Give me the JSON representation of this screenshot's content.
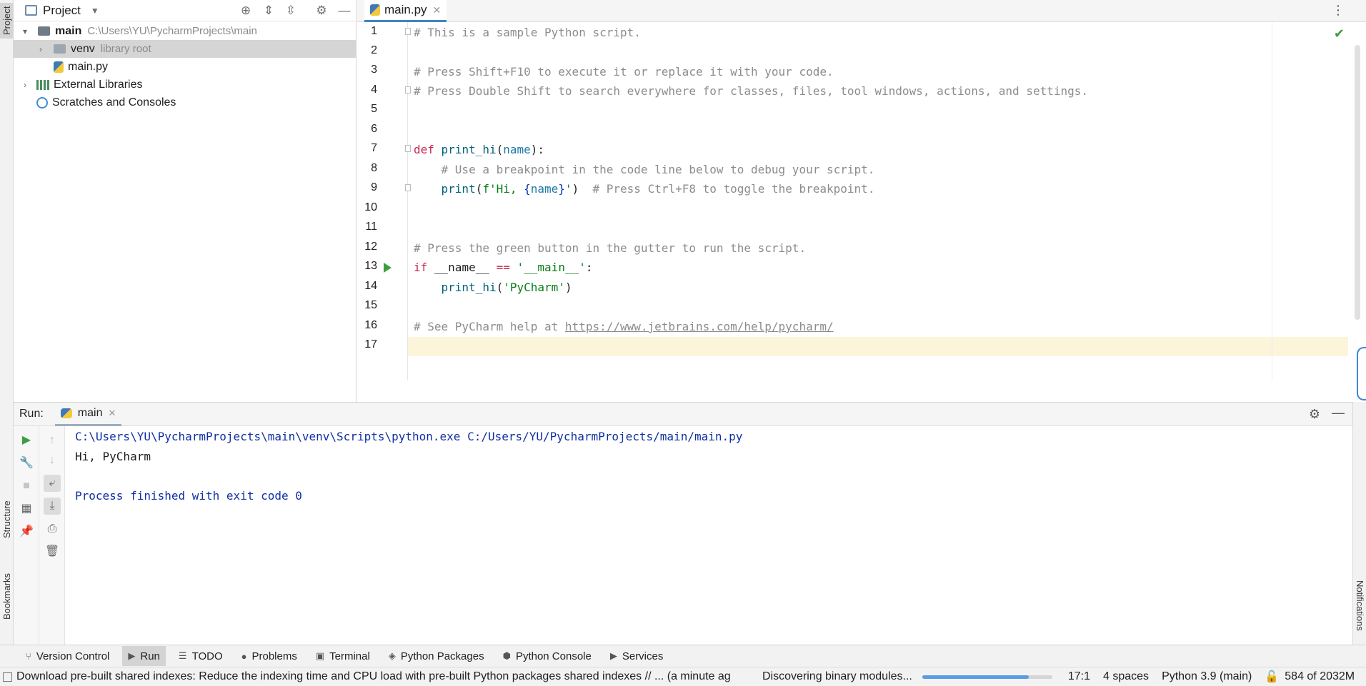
{
  "project_panel": {
    "title": "Project",
    "tree": [
      {
        "label": "main",
        "detail": "C:\\Users\\YU\\PycharmProjects\\main"
      },
      {
        "label": "venv",
        "detail": "library root"
      },
      {
        "label": "main.py"
      },
      {
        "label": "External Libraries"
      },
      {
        "label": "Scratches and Consoles"
      }
    ]
  },
  "left_stripe": {
    "project": "Project",
    "structure": "Structure",
    "bookmarks": "Bookmarks"
  },
  "editor": {
    "tab": "main.py",
    "line_numbers": [
      "1",
      "2",
      "3",
      "4",
      "5",
      "6",
      "7",
      "8",
      "9",
      "10",
      "11",
      "12",
      "13",
      "14",
      "15",
      "16",
      "17"
    ],
    "lines": {
      "l1": "# This is a sample Python script.",
      "l3": "# Press Shift+F10 to execute it or replace it with your code.",
      "l4": "# Press Double Shift to search everywhere for classes, files, tool windows, actions, and settings.",
      "l7_kw": "def",
      "l7_fn": "print_hi",
      "l7_p1": "(",
      "l7_param": "name",
      "l7_p2": "):",
      "l8": "# Use a breakpoint in the code line below to debug your script.",
      "l9_fn": "print",
      "l9_open": "(",
      "l9_str1": "f'Hi, ",
      "l9_brace": "{",
      "l9_param": "name",
      "l9_brace2": "}",
      "l9_str2": "'",
      "l9_close": ")",
      "l9_cmt": "# Press Ctrl+F8 to toggle the breakpoint.",
      "l12": "# Press the green button in the gutter to run the script.",
      "l13_kw": "if",
      "l13_name": "__name__",
      "l13_op": "==",
      "l13_str": "'__main__'",
      "l13_colon": ":",
      "l14_fn": "print_hi",
      "l14_open": "(",
      "l14_str": "'PyCharm'",
      "l14_close": ")",
      "l16_cmt": "# See PyCharm help at ",
      "l16_link": "https://www.jetbrains.com/help/pycharm/"
    }
  },
  "run_window": {
    "label": "Run:",
    "tab": "main",
    "console": {
      "command": "C:\\Users\\YU\\PycharmProjects\\main\\venv\\Scripts\\python.exe C:/Users/YU/PycharmProjects/main/main.py",
      "output": "Hi, PyCharm",
      "finished": "Process finished with exit code 0"
    }
  },
  "right_stripe": {
    "notifications": "Notifications"
  },
  "tool_windows": [
    "Version Control",
    "Run",
    "TODO",
    "Problems",
    "Terminal",
    "Python Packages",
    "Python Console",
    "Services"
  ],
  "status_bar": {
    "message": "Download pre-built shared indexes: Reduce the indexing time and CPU load with pre-built Python packages shared indexes // ... (a minute ag",
    "task": "Discovering binary modules...",
    "progress": 0.82,
    "caret": "17:1",
    "indent": "4 spaces",
    "interpreter": "Python 3.9 (main)",
    "memory": "584 of 2032M"
  },
  "colors": {
    "accent": "#4083c9",
    "run_green": "#3d9e41",
    "current_line": "#fcf5da",
    "console_blue": "#0f2fa3"
  }
}
